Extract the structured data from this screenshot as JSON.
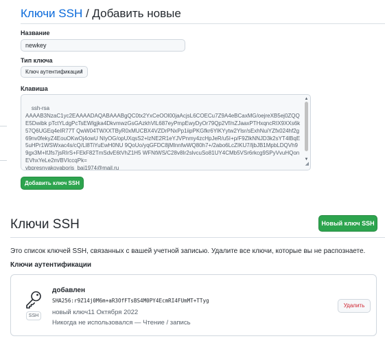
{
  "form": {
    "breadcrumb_link": "Ключи SSH",
    "breadcrumb_sep": " / ",
    "title": "Добавить новые",
    "title_label": "Название",
    "title_value": "newkey",
    "key_type_label": "Тип ключа",
    "key_type_value": "Ключ аутентификации",
    "key_label": "Клавиша",
    "key_value": "ssh-rsa\nAAAAB3NzaC1yc2EAAAADAQABAAABgQC0tx2YxCeOOl00jaAcjsL6COECu7Z9A4eBCaxMG/oejreXB5ej0ZQQE5Dwibk pTctYLdgPcTsEWlgjka4DkvmwzGsGAzkhVlL687eyPmpEwyDyOr79Qp2Vf/nZJaaxPTHxqncRIX9XXs6k57Q6UGEq4eIR77T QwW04TWXXTByR0xMUCBX4VZDrPNxPp1iipPKGfkr6YlKYytw2Ylsr/sExhNuiYZfx024hf2g69nv0fekyZ4EouOKwOj4owU NIyOG/opUXqsS2+lzNE2R1eYJVPnmy4zcHpJeR/u5I+p/F9ZlkNNJD3k2sYT4lBqE5uHPr1WSWxac4s/cQ/Ll8TiYuEwH0NU 9QoUo/yqGFDC8jMlnnfwWQ80h7+/2abo6LcZIKU7/ljbJB1MpbLDQVh99gx3M+lfJfs7jsRIrS+FEkF82TmSdvE6tVhZ1H5 WFNtWS/C28v8Ir2slvcuSo81UY4CMb5VSr6rkcg9SPyVvuHQonEVhxYeLe2m/BVIccqPk=\nvbpresnyakovaboris_bai1974@mail.ru",
    "submit_label": "Добавить ключ SSH"
  },
  "keys": {
    "title": "Ключи SSH",
    "new_key_label": "Новый ключ SSH",
    "description": "Это список ключей SSH, связанных с вашей учетной записью. Удалите все ключи, которые вы не распознаете.",
    "auth_heading": "Ключи аутентификации",
    "items": [
      {
        "name": "добавлен",
        "fingerprint": "SHA256:r9Z14j0M6m+aR3OfFTsBS4M0PY4EcmRI4FUmMT+TTyg",
        "added": "новый ключ11 Октября 2022",
        "usage": "Никогда не использовался — Чтение / запись",
        "badge": "SSH",
        "icon": "key-icon",
        "delete_label": "Удалить"
      }
    ]
  },
  "colors": {
    "accent_link": "#0969da",
    "primary_button": "#2da44e",
    "danger_text": "#cf222e"
  }
}
